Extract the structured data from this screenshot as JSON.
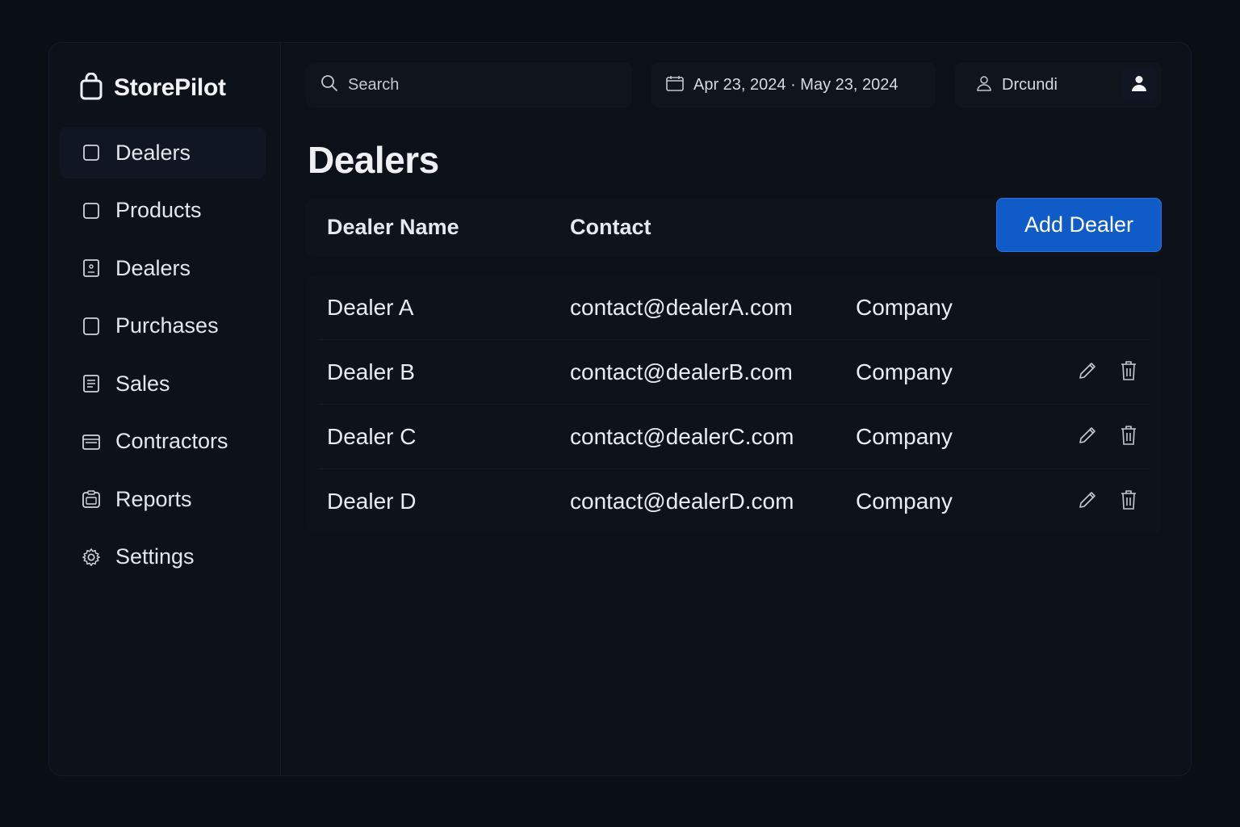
{
  "app": {
    "brand": "StorePilot",
    "brand_icon": "shopping-bag-icon"
  },
  "sidebar": {
    "items": [
      {
        "label": "Dealers",
        "icon": "square-icon",
        "active": true
      },
      {
        "label": "Products",
        "icon": "square-icon",
        "active": false
      },
      {
        "label": "Dealers",
        "icon": "id-badge-icon",
        "active": false
      },
      {
        "label": "Purchases",
        "icon": "rounded-square-icon",
        "active": false
      },
      {
        "label": "Sales",
        "icon": "document-lines-icon",
        "active": false
      },
      {
        "label": "Contractors",
        "icon": "card-icon",
        "active": false
      },
      {
        "label": "Reports",
        "icon": "clipboard-icon",
        "active": false
      },
      {
        "label": "Settings",
        "icon": "gear-icon",
        "active": false
      }
    ]
  },
  "topbar": {
    "search_placeholder": "Search",
    "date_range": "Apr 23, 2024 · May 23, 2024",
    "user_name": "Drcundi"
  },
  "main": {
    "title": "Dealers",
    "add_button_label": "Add Dealer",
    "columns": [
      "Dealer Name",
      "Contact"
    ],
    "rows": [
      {
        "name": "Dealer A",
        "contact": "contact@dealerA.com",
        "type": "Company",
        "actions": false
      },
      {
        "name": "Dealer B",
        "contact": "contact@dealerB.com",
        "type": "Company",
        "actions": true
      },
      {
        "name": "Dealer C",
        "contact": "contact@dealerC.com",
        "type": "Company",
        "actions": true
      },
      {
        "name": "Dealer D",
        "contact": "contact@dealerD.com",
        "type": "Company",
        "actions": true
      }
    ]
  },
  "colors": {
    "background": "#0a0e15",
    "accent": "#0f5cc9",
    "text": "#e6e9ef"
  }
}
